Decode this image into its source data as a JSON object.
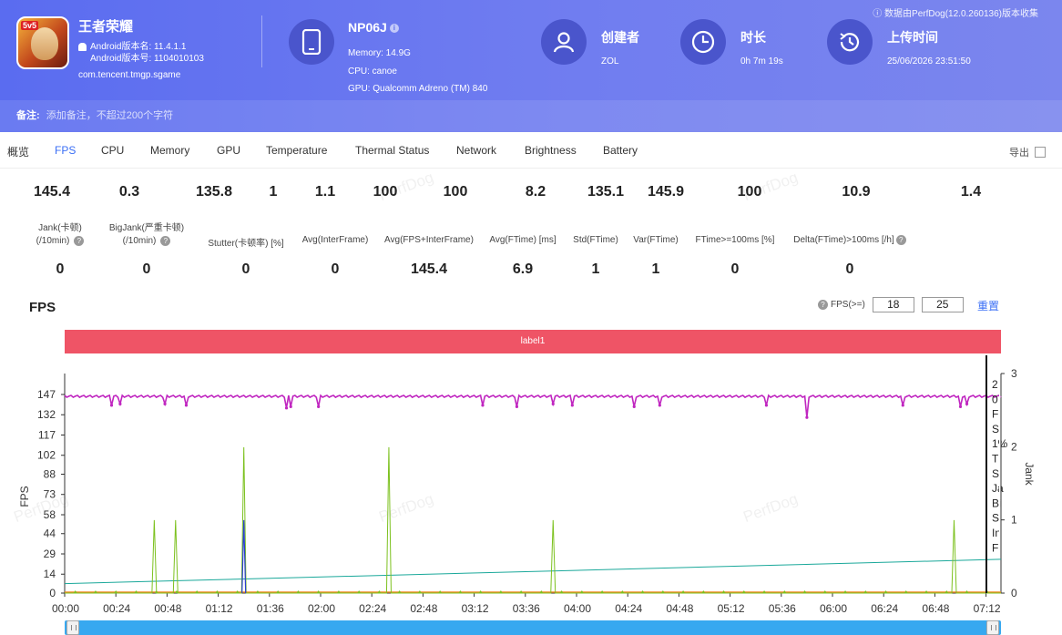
{
  "app": {
    "name": "王者荣耀",
    "android_version_name": "Android版本名: 11.4.1.1",
    "android_version_code": "Android版本号: 1104010103",
    "package": "com.tencent.tmgp.sgame",
    "icon_tag": "5v5"
  },
  "device": {
    "name": "NP06J",
    "memory": "Memory: 14.9G",
    "cpu": "CPU: canoe",
    "gpu": "GPU: Qualcomm Adreno (TM) 840"
  },
  "creator": {
    "title": "创建者",
    "value": "ZOL"
  },
  "duration": {
    "title": "时长",
    "value": "0h 7m 19s"
  },
  "upload": {
    "title": "上传时间",
    "value": "25/06/2026 23:51:50"
  },
  "perfdog_note": "数据由PerfDog(12.0.260136)版本收集",
  "remark": {
    "label": "备注:",
    "placeholder": "添加备注，不超过200个字符"
  },
  "tabs": [
    "概览",
    "FPS",
    "CPU",
    "Memory",
    "GPU",
    "Temperature",
    "Thermal Status",
    "Network",
    "Brightness",
    "Battery"
  ],
  "active_tab": "FPS",
  "export_label": "导出",
  "top_stats": [
    "145.4",
    "0.3",
    "135.8",
    "1",
    "1.1",
    "100",
    "100",
    "8.2",
    "135.1",
    "145.9",
    "100",
    "10.9",
    "1.4"
  ],
  "stats": [
    {
      "label1": "Jank(卡顿)",
      "label2": "(/10min)",
      "help": true,
      "value": "0"
    },
    {
      "label1": "BigJank(严重卡顿)",
      "label2": "(/10min)",
      "help": true,
      "value": "0"
    },
    {
      "label1": "Stutter(卡顿率) [%]",
      "label2": "",
      "value": "0"
    },
    {
      "label1": "Avg(InterFrame)",
      "label2": "",
      "value": "0"
    },
    {
      "label1": "Avg(FPS+InterFrame)",
      "label2": "",
      "value": "145.4"
    },
    {
      "label1": "Avg(FTime) [ms]",
      "label2": "",
      "value": "6.9"
    },
    {
      "label1": "Std(FTime)",
      "label2": "",
      "value": "1"
    },
    {
      "label1": "Var(FTime)",
      "label2": "",
      "value": "1"
    },
    {
      "label1": "FTime>=100ms [%]",
      "label2": "",
      "value": "0"
    },
    {
      "label1": "Delta(FTime)>100ms [/h]",
      "label2": "",
      "help": true,
      "value": "0"
    }
  ],
  "chart_section": {
    "title": "FPS",
    "filter_label": "FPS(>=)",
    "filter_values": [
      "18",
      "25"
    ],
    "reset_label": "重置",
    "label_bar": "label1",
    "watermark": "PerfDog"
  },
  "chart_data": {
    "type": "line",
    "ylabel": "FPS",
    "y2label": "Jank",
    "yticks": [
      0,
      14,
      29,
      44,
      58,
      73,
      88,
      102,
      117,
      132,
      147
    ],
    "y2ticks": [
      0,
      1,
      2,
      3
    ],
    "xticks": [
      "00:00",
      "00:24",
      "00:48",
      "01:12",
      "01:36",
      "02:00",
      "02:24",
      "02:48",
      "03:12",
      "03:36",
      "04:00",
      "04:24",
      "04:48",
      "05:12",
      "05:36",
      "06:00",
      "06:24",
      "06:48",
      "07:12"
    ],
    "x_range_seconds": [
      0,
      439
    ],
    "series": [
      {
        "name": "FPS",
        "color": "#c026c0",
        "baseline": 145.5,
        "dips": [
          [
            22,
            139
          ],
          [
            26,
            140
          ],
          [
            47,
            140
          ],
          [
            57,
            139
          ],
          [
            104,
            137
          ],
          [
            106,
            138
          ],
          [
            119,
            138
          ],
          [
            196,
            139
          ],
          [
            212,
            138
          ],
          [
            229,
            140
          ],
          [
            238,
            139
          ],
          [
            267,
            138
          ],
          [
            279,
            139
          ],
          [
            329,
            139
          ],
          [
            348,
            130
          ],
          [
            393,
            139
          ],
          [
            420,
            138
          ],
          [
            423,
            140
          ]
        ]
      },
      {
        "name": "FTime",
        "color": "#7cc11e",
        "spikes": [
          [
            42,
            54
          ],
          [
            52,
            54
          ],
          [
            84,
            108
          ],
          [
            152,
            108
          ],
          [
            229,
            54
          ],
          [
            417,
            54
          ]
        ]
      },
      {
        "name": "Jank",
        "color": "#2b3fd0",
        "spikes": [
          [
            84,
            54
          ]
        ]
      },
      {
        "name": "Trend",
        "color": "#1aa89a",
        "start": 7,
        "end": 25
      }
    ]
  },
  "legend_partial": [
    "2",
    "0",
    "Fl",
    "S",
    "1%",
    "Tl",
    "S",
    "Ja",
    "Bi",
    "S",
    "In",
    "Fl"
  ]
}
